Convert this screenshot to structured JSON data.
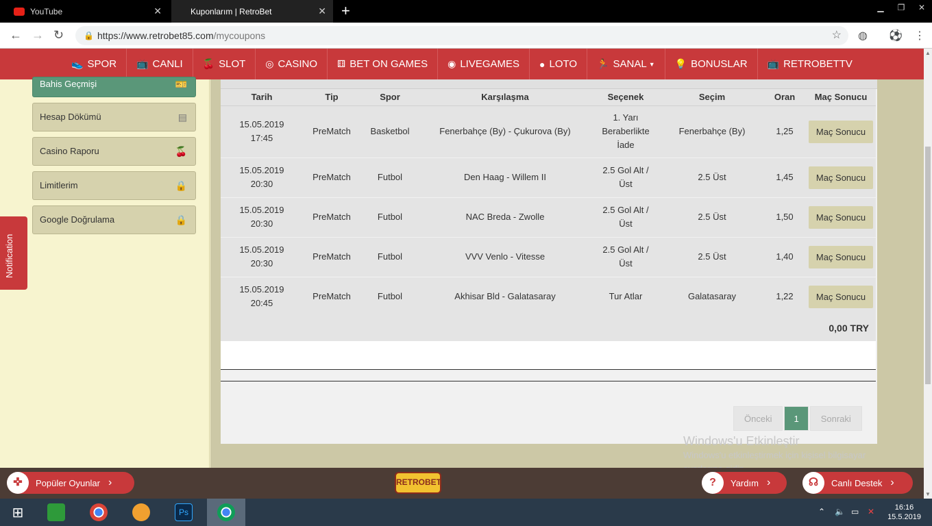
{
  "browser": {
    "tabs": [
      {
        "title": "YouTube",
        "active": false
      },
      {
        "title": "Kuponlarım | RetroBet",
        "active": true
      }
    ],
    "url_host": "https://www.retrobet85.com",
    "url_path": "/mycoupons"
  },
  "nav": [
    "SPOR",
    "CANLI",
    "SLOT",
    "CASINO",
    "BET ON GAMES",
    "LIVEGAMES",
    "LOTO",
    "SANAL",
    "BONUSLAR",
    "RETROBETTV"
  ],
  "sidebar": {
    "items": [
      "Bahis Geçmişi",
      "Hesap Dökümü",
      "Casino Raporu",
      "Limitlerim",
      "Google Doğrulama"
    ],
    "notification": "Notification"
  },
  "table": {
    "headers": [
      "Tarih",
      "Tip",
      "Spor",
      "Karşılaşma",
      "Seçenek",
      "Seçim",
      "Oran",
      "Maç Sonucu"
    ],
    "rows": [
      {
        "date": "15.05.2019",
        "time": "17:45",
        "tip": "PreMatch",
        "spor": "Basketbol",
        "match": "Fenerbahçe (By) - Çukurova (By)",
        "option": "1. Yarı Beraberlikte İade",
        "pick": "Fenerbahçe (By)",
        "odd": "1,25",
        "btn": "Maç Sonucu"
      },
      {
        "date": "15.05.2019",
        "time": "20:30",
        "tip": "PreMatch",
        "spor": "Futbol",
        "match": "Den Haag - Willem II",
        "option": "2.5 Gol Alt / Üst",
        "pick": "2.5 Üst",
        "odd": "1,45",
        "btn": "Maç Sonucu"
      },
      {
        "date": "15.05.2019",
        "time": "20:30",
        "tip": "PreMatch",
        "spor": "Futbol",
        "match": "NAC Breda - Zwolle",
        "option": "2.5 Gol Alt / Üst",
        "pick": "2.5 Üst",
        "odd": "1,50",
        "btn": "Maç Sonucu"
      },
      {
        "date": "15.05.2019",
        "time": "20:30",
        "tip": "PreMatch",
        "spor": "Futbol",
        "match": "VVV Venlo - Vitesse",
        "option": "2.5 Gol Alt / Üst",
        "pick": "2.5 Üst",
        "odd": "1,40",
        "btn": "Maç Sonucu"
      },
      {
        "date": "15.05.2019",
        "time": "20:45",
        "tip": "PreMatch",
        "spor": "Futbol",
        "match": "Akhisar Bld - Galatasaray",
        "option": "Tur Atlar",
        "pick": "Galatasaray",
        "odd": "1,22",
        "btn": "Maç Sonucu"
      }
    ],
    "total": "0,00 TRY"
  },
  "pager": {
    "prev": "Önceki",
    "current": "1",
    "next": "Sonraki"
  },
  "watermark": {
    "title": "Windows'u Etkinleştir",
    "text": "Windows'u etkinleştirmek için kişisel bilgisayar ayarlarına gidin."
  },
  "bottom": {
    "popular": "Popüler Oyunlar",
    "help": "Yardım",
    "support": "Canlı Destek",
    "logo": "RETROBET"
  },
  "taskbar": {
    "time": "16:16",
    "date": "15.5.2019"
  },
  "colors": {
    "brand_red": "#c8393b",
    "accent_green": "#5a9779",
    "cream": "#f7f4cf"
  }
}
